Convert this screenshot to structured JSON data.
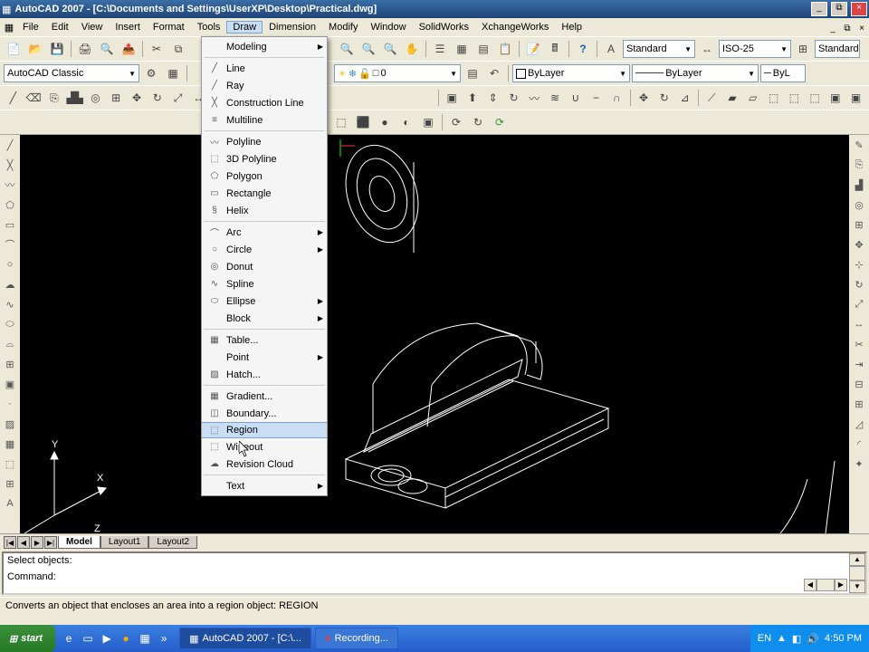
{
  "title": "AutoCAD 2007 - [C:\\Documents and Settings\\UserXP\\Desktop\\Practical.dwg]",
  "menubar": [
    "File",
    "Edit",
    "View",
    "Insert",
    "Format",
    "Tools",
    "Draw",
    "Dimension",
    "Modify",
    "Window",
    "SolidWorks",
    "XchangeWorks",
    "Help"
  ],
  "active_menu": 6,
  "workspace": "AutoCAD Classic",
  "textstyle": "Standard",
  "dimstyle": "ISO-25",
  "tablestyle": "Standard",
  "layer": "0",
  "color_combo": "ByLayer",
  "linetype_combo": "ByLayer",
  "lineweight_combo": "ByL",
  "draw_menu": {
    "highlight": "Region",
    "groups": [
      [
        {
          "icon": "",
          "label": "Modeling",
          "arrow": true
        }
      ],
      [
        {
          "icon": "╱",
          "label": "Line"
        },
        {
          "icon": "╱",
          "label": "Ray"
        },
        {
          "icon": "╳",
          "label": "Construction Line"
        },
        {
          "icon": "≡",
          "label": "Multiline"
        }
      ],
      [
        {
          "icon": "〰",
          "label": "Polyline"
        },
        {
          "icon": "⬚",
          "label": "3D Polyline"
        },
        {
          "icon": "⬠",
          "label": "Polygon"
        },
        {
          "icon": "▭",
          "label": "Rectangle"
        },
        {
          "icon": "§",
          "label": "Helix"
        }
      ],
      [
        {
          "icon": "⌒",
          "label": "Arc",
          "arrow": true
        },
        {
          "icon": "○",
          "label": "Circle",
          "arrow": true
        },
        {
          "icon": "◎",
          "label": "Donut"
        },
        {
          "icon": "∿",
          "label": "Spline"
        },
        {
          "icon": "⬭",
          "label": "Ellipse",
          "arrow": true
        },
        {
          "icon": "",
          "label": "Block",
          "arrow": true
        }
      ],
      [
        {
          "icon": "▦",
          "label": "Table..."
        },
        {
          "icon": "",
          "label": "Point",
          "arrow": true
        },
        {
          "icon": "▨",
          "label": "Hatch..."
        }
      ],
      [
        {
          "icon": "▦",
          "label": "Gradient..."
        },
        {
          "icon": "◫",
          "label": "Boundary..."
        },
        {
          "icon": "⬚",
          "label": "Region"
        },
        {
          "icon": "⬚",
          "label": "Wipeout"
        },
        {
          "icon": "☁",
          "label": "Revision Cloud"
        }
      ],
      [
        {
          "icon": "",
          "label": "Text",
          "arrow": true
        }
      ]
    ]
  },
  "tabs": {
    "active": "Model",
    "items": [
      "Model",
      "Layout1",
      "Layout2"
    ]
  },
  "cli": {
    "line1": "Select objects:",
    "line2": "Command:"
  },
  "status": "Converts an object that encloses an area into a region object:   REGION",
  "taskbar": {
    "start": "start",
    "tasks": [
      {
        "label": "AutoCAD 2007 - [C:\\..."
      },
      {
        "label": "Recording..."
      }
    ],
    "tray": {
      "lang": "EN",
      "time": "4:50 PM"
    }
  },
  "ucs": {
    "x": "X",
    "y": "Y",
    "z": "Z"
  }
}
